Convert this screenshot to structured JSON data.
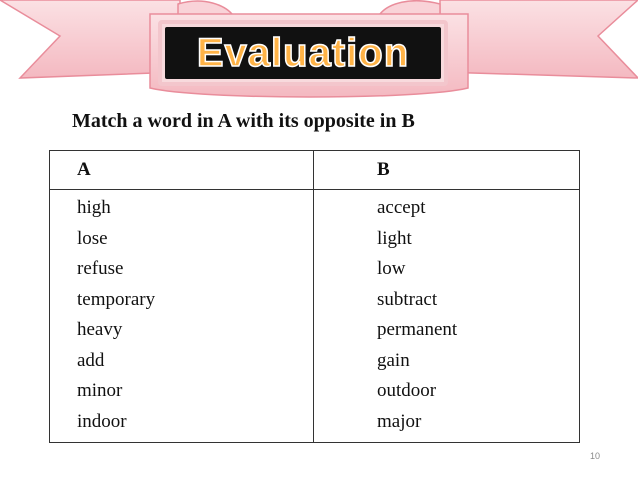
{
  "slide": {
    "title": "Evaluation",
    "instruction": "Match a word in A with its opposite in B",
    "page_number": "10"
  },
  "table": {
    "header_a": "A",
    "header_b": "B",
    "column_a": [
      "high",
      "lose",
      "refuse",
      "temporary",
      "heavy",
      "add",
      "minor",
      "indoor"
    ],
    "column_b": [
      "accept",
      "light",
      "low",
      "subtract",
      "permanent",
      "gain",
      "outdoor",
      "major"
    ]
  },
  "colors": {
    "ribbon_fill": "#f7c9cf",
    "ribbon_stroke": "#e98d9b",
    "title_text": "#ffb347",
    "title_background": "#111111"
  }
}
